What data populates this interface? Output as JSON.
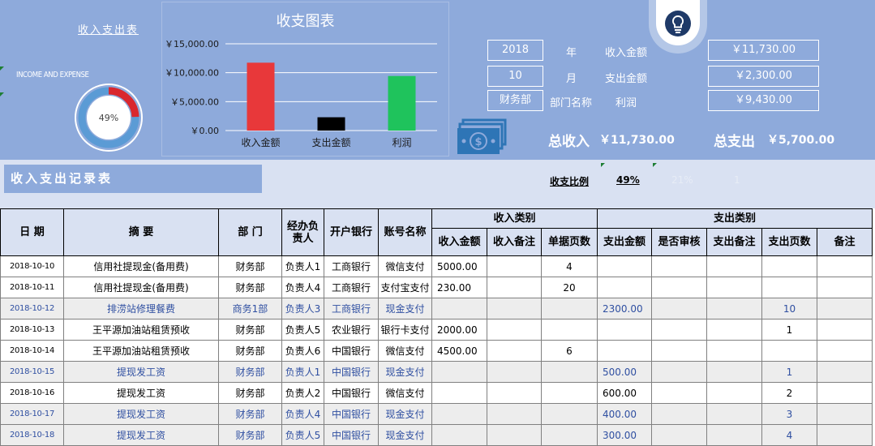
{
  "header": {
    "sheet_link": "收入支出表",
    "brand_caption": "INCOME AND EXPENSE",
    "donut_percent": "49%",
    "donut_fraction": 0.49
  },
  "chart_data": {
    "type": "bar",
    "title": "收支图表",
    "categories": [
      "收入金额",
      "支出金额",
      "利润"
    ],
    "values": [
      11730,
      2300,
      9430
    ],
    "ylim": [
      0,
      15000
    ],
    "yticks": [
      "￥0.00",
      "￥5,000.00",
      "￥10,000.00",
      "￥15,000.00"
    ],
    "ytick_values": [
      0,
      5000,
      10000,
      15000
    ],
    "colors": [
      "#e8383a",
      "#000000",
      "#1fc35c"
    ],
    "grid": true
  },
  "summary": {
    "year_value": "2018",
    "year_label": "年",
    "month_value": "10",
    "month_label": "月",
    "dept_value": "财务部",
    "dept_label": "部门名称",
    "income_label": "收入金额",
    "income_value": "￥11,730.00",
    "expense_label": "支出金额",
    "expense_value": "￥2,300.00",
    "profit_label": "利润",
    "profit_value": "￥9,430.00",
    "total_income_label": "总收入",
    "total_income_value": "￥11,730.00",
    "total_expense_label": "总支出",
    "total_expense_value": "￥5,700.00"
  },
  "records": {
    "title": "收入支出记录表",
    "ratio_label": "收支比例",
    "ratio_value": "49%",
    "faded_a": "21%",
    "faded_b": "1"
  },
  "table": {
    "headers": {
      "date": "日 期",
      "summary": "摘        要",
      "dept": "部    门",
      "handler": "经办负责人",
      "bank": "开户银行",
      "account": "账号名称",
      "income_group": "收入类别",
      "expense_group": "支出类别",
      "income_amount": "收入金额",
      "income_note": "收入备注",
      "income_pages": "单据页数",
      "expense_amount": "支出金额",
      "audited": "是否审核",
      "expense_note": "支出备注",
      "expense_pages": "支出页数",
      "note": "备注"
    },
    "rows": [
      {
        "date": "2018-10-10",
        "summary": "信用社提现金(备用费)",
        "dept": "财务部",
        "handler": "负责人1",
        "bank": "工商银行",
        "account": "微信支付",
        "income_amount": "5000.00",
        "income_note": "",
        "income_pages": "4",
        "expense_amount": "",
        "audited": "",
        "expense_note": "",
        "expense_pages": "",
        "note": "",
        "alt": false
      },
      {
        "date": "2018-10-11",
        "summary": "信用社提现金(备用费)",
        "dept": "财务部",
        "handler": "负责人4",
        "bank": "工商银行",
        "account": "支付宝支付",
        "income_amount": "230.00",
        "income_note": "",
        "income_pages": "20",
        "expense_amount": "",
        "audited": "",
        "expense_note": "",
        "expense_pages": "",
        "note": "",
        "alt": false
      },
      {
        "date": "2018-10-12",
        "summary": "排涝站修理餐费",
        "dept": "商务1部",
        "handler": "负责人3",
        "bank": "工商银行",
        "account": "现金支付",
        "income_amount": "",
        "income_note": "",
        "income_pages": "",
        "expense_amount": "2300.00",
        "audited": "",
        "expense_note": "",
        "expense_pages": "10",
        "note": "",
        "alt": true
      },
      {
        "date": "2018-10-13",
        "summary": "王平源加油站租赁预收",
        "dept": "财务部",
        "handler": "负责人5",
        "bank": "农业银行",
        "account": "银行卡支付",
        "income_amount": "2000.00",
        "income_note": "",
        "income_pages": "",
        "expense_amount": "",
        "audited": "",
        "expense_note": "",
        "expense_pages": "1",
        "note": "",
        "alt": false
      },
      {
        "date": "2018-10-14",
        "summary": "王平源加油站租赁预收",
        "dept": "财务部",
        "handler": "负责人6",
        "bank": "中国银行",
        "account": "微信支付",
        "income_amount": "4500.00",
        "income_note": "",
        "income_pages": "6",
        "expense_amount": "",
        "audited": "",
        "expense_note": "",
        "expense_pages": "",
        "note": "",
        "alt": false
      },
      {
        "date": "2018-10-15",
        "summary": "提现发工资",
        "dept": "财务部",
        "handler": "负责人1",
        "bank": "中国银行",
        "account": "现金支付",
        "income_amount": "",
        "income_note": "",
        "income_pages": "",
        "expense_amount": "500.00",
        "audited": "",
        "expense_note": "",
        "expense_pages": "1",
        "note": "",
        "alt": true
      },
      {
        "date": "2018-10-16",
        "summary": "提现发工资",
        "dept": "财务部",
        "handler": "负责人2",
        "bank": "中国银行",
        "account": "微信支付",
        "income_amount": "",
        "income_note": "",
        "income_pages": "",
        "expense_amount": "600.00",
        "audited": "",
        "expense_note": "",
        "expense_pages": "2",
        "note": "",
        "alt": false
      },
      {
        "date": "2018-10-17",
        "summary": "提现发工资",
        "dept": "财务部",
        "handler": "负责人4",
        "bank": "中国银行",
        "account": "现金支付",
        "income_amount": "",
        "income_note": "",
        "income_pages": "",
        "expense_amount": "400.00",
        "audited": "",
        "expense_note": "",
        "expense_pages": "3",
        "note": "",
        "alt": true
      },
      {
        "date": "2018-10-18",
        "summary": "提现发工资",
        "dept": "财务部",
        "handler": "负责人5",
        "bank": "中国银行",
        "account": "现金支付",
        "income_amount": "",
        "income_note": "",
        "income_pages": "",
        "expense_amount": "300.00",
        "audited": "",
        "expense_note": "",
        "expense_pages": "4",
        "note": "",
        "alt": true
      }
    ]
  },
  "icons": {
    "bulb": "lightbulb-icon",
    "money": "money-stack-icon"
  },
  "colors": {
    "header_bg": "#8eaadb",
    "strip_bg": "#d9e1f2",
    "alt_row_text": "#2f4fa1",
    "donut_red": "#d9272e",
    "donut_blue": "#5b9bd5"
  }
}
